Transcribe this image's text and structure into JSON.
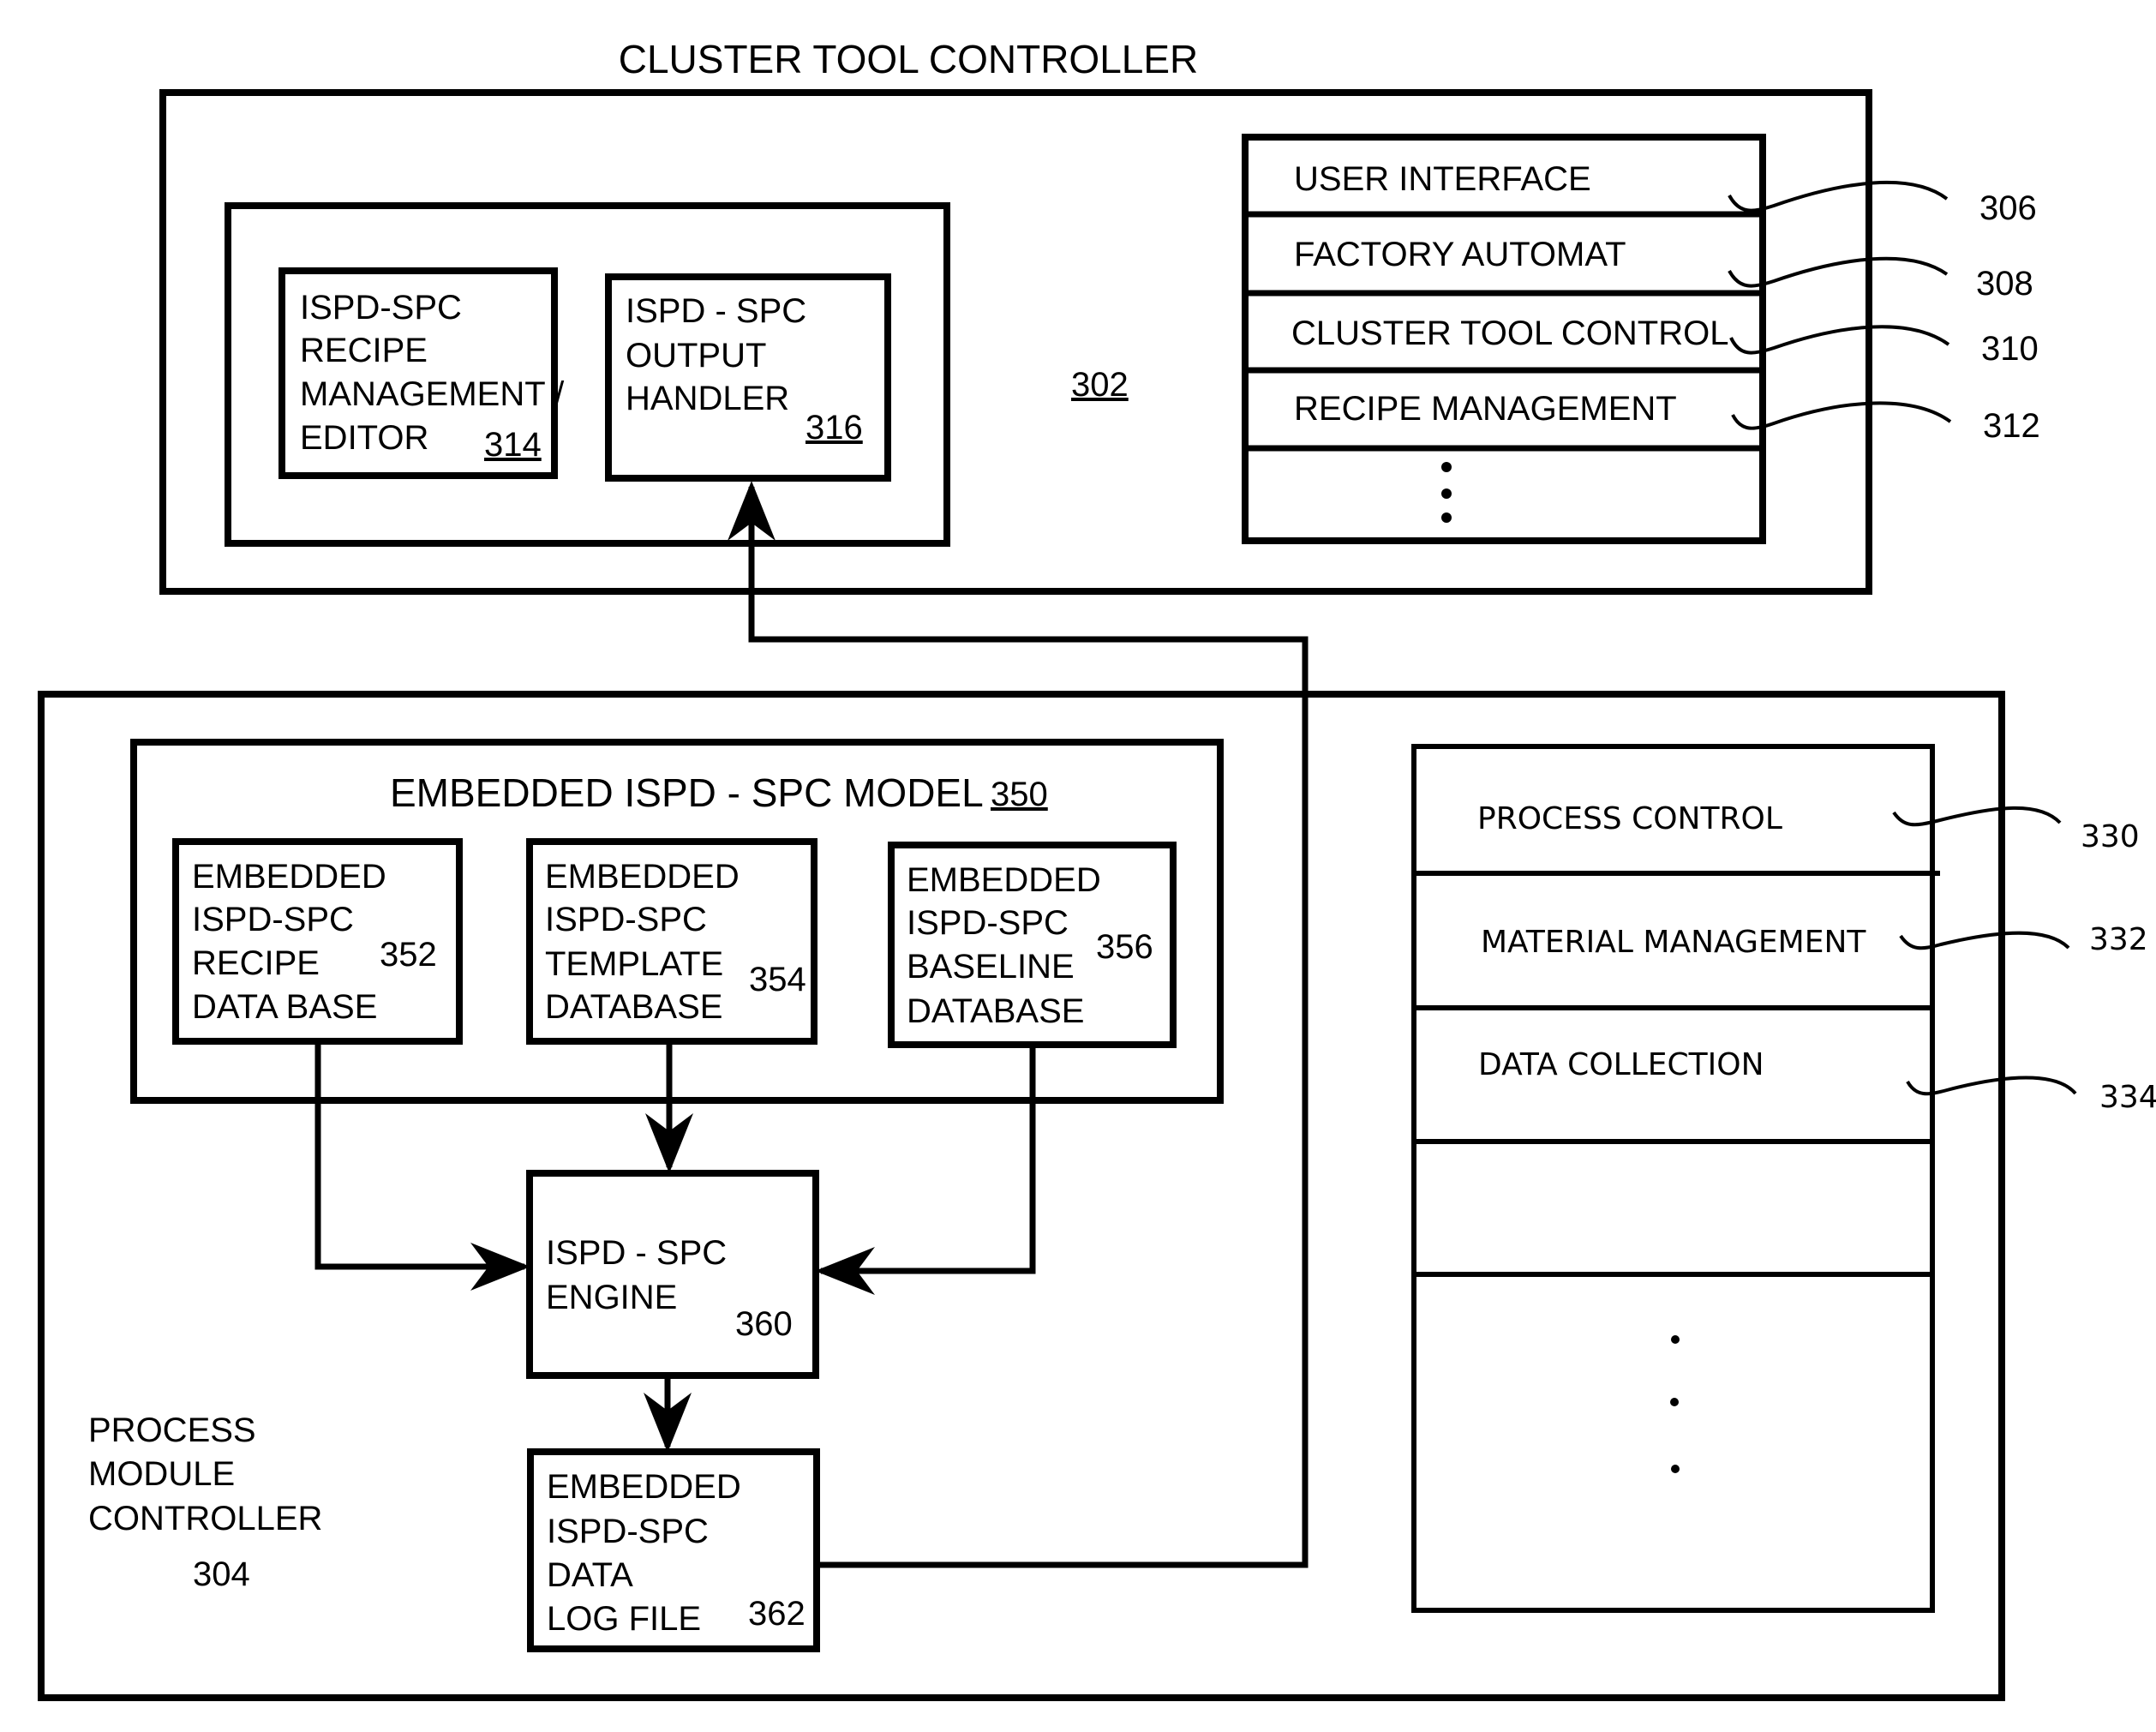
{
  "cluster_tool_controller": {
    "title": "CLUSTER TOOL CONTROLLER",
    "ref": "302",
    "recipe_editor": {
      "lines": [
        "ISPD-SPC",
        "RECIPE",
        "MANAGEMENT /",
        "EDITOR"
      ],
      "ref": "314"
    },
    "output_handler": {
      "lines": [
        "ISPD - SPC",
        "OUTPUT",
        "HANDLER"
      ],
      "ref": "316"
    },
    "stack": [
      {
        "label": "USER INTERFACE",
        "ref": "306"
      },
      {
        "label": "FACTORY AUTOMAT",
        "ref": "308"
      },
      {
        "label": "CLUSTER TOOL CONTROL",
        "ref": "310"
      },
      {
        "label": "RECIPE MANAGEMENT",
        "ref": "312"
      }
    ],
    "stack_more": "ellipsis-vertical"
  },
  "process_module_controller": {
    "lines": [
      "PROCESS",
      "MODULE",
      "CONTROLLER"
    ],
    "ref": "304",
    "model": {
      "title": "EMBEDDED ISPD - SPC MODEL",
      "ref": "350",
      "recipe_db": {
        "lines": [
          "EMBEDDED",
          "ISPD-SPC",
          "RECIPE",
          "DATA BASE"
        ],
        "ref": "352"
      },
      "template_db": {
        "lines": [
          "EMBEDDED",
          "ISPD-SPC",
          "TEMPLATE",
          "DATABASE"
        ],
        "ref": "354"
      },
      "baseline_db": {
        "lines": [
          "EMBEDDED",
          "ISPD-SPC",
          "BASELINE",
          "DATABASE"
        ],
        "ref": "356"
      }
    },
    "engine": {
      "lines": [
        "ISPD - SPC",
        "ENGINE"
      ],
      "ref": "360"
    },
    "log_file": {
      "lines": [
        "EMBEDDED",
        "ISPD-SPC",
        "DATA",
        "LOG FILE"
      ],
      "ref": "362"
    },
    "stack": [
      {
        "label": "PROCESS CONTROL",
        "ref": "330"
      },
      {
        "label": "MATERIAL MANAGEMENT",
        "ref": "332"
      },
      {
        "label": "DATA COLLECTION",
        "ref": "334"
      }
    ],
    "stack_more": "ellipsis-vertical"
  }
}
